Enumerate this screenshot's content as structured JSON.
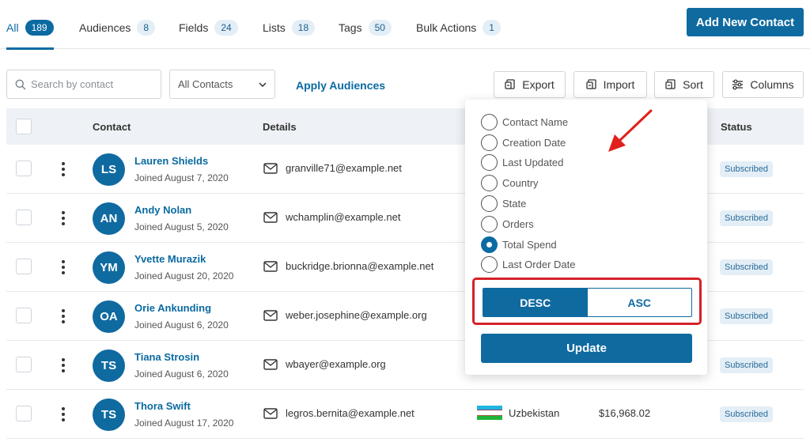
{
  "tabs": [
    {
      "label": "All",
      "count": "189"
    },
    {
      "label": "Audiences",
      "count": "8"
    },
    {
      "label": "Fields",
      "count": "24"
    },
    {
      "label": "Lists",
      "count": "18"
    },
    {
      "label": "Tags",
      "count": "50"
    },
    {
      "label": "Bulk Actions",
      "count": "1"
    }
  ],
  "header": {
    "add_button": "Add New Contact"
  },
  "toolbar": {
    "search_placeholder": "Search by contact",
    "filter_value": "All Contacts",
    "apply_audiences": "Apply Audiences",
    "export": "Export",
    "import": "Import",
    "sort": "Sort",
    "columns": "Columns"
  },
  "table": {
    "headers": {
      "contact": "Contact",
      "details": "Details",
      "status": "Status"
    },
    "rows": [
      {
        "initials": "LS",
        "name": "Lauren Shields",
        "joined": "Joined August 7, 2020",
        "email": "granville71@example.net",
        "status": "Subscribed"
      },
      {
        "initials": "AN",
        "name": "Andy Nolan",
        "joined": "Joined August 5, 2020",
        "email": "wchamplin@example.net",
        "status": "Subscribed"
      },
      {
        "initials": "YM",
        "name": "Yvette Murazik",
        "joined": "Joined August 20, 2020",
        "email": "buckridge.brionna@example.net",
        "status": "Subscribed"
      },
      {
        "initials": "OA",
        "name": "Orie Ankunding",
        "joined": "Joined August 6, 2020",
        "email": "weber.josephine@example.org",
        "status": "Subscribed"
      },
      {
        "initials": "TS",
        "name": "Tiana Strosin",
        "joined": "Joined August 6, 2020",
        "email": "wbayer@example.org",
        "status": "Subscribed"
      },
      {
        "initials": "TS",
        "name": "Thora Swift",
        "joined": "Joined August 17, 2020",
        "email": "legros.bernita@example.net",
        "country": "Uzbekistan",
        "spend": "$16,968.02",
        "status": "Subscribed"
      }
    ]
  },
  "sort_menu": {
    "options": [
      "Contact Name",
      "Creation Date",
      "Last Updated",
      "Country",
      "State",
      "Orders",
      "Total Spend",
      "Last Order Date"
    ],
    "selected": "Total Spend",
    "order_desc": "DESC",
    "order_asc": "ASC",
    "selected_order": "DESC",
    "update": "Update"
  },
  "colors": {
    "primary": "#0f6aa0",
    "highlight": "#d62129",
    "badge_bg": "#e3eef6"
  }
}
